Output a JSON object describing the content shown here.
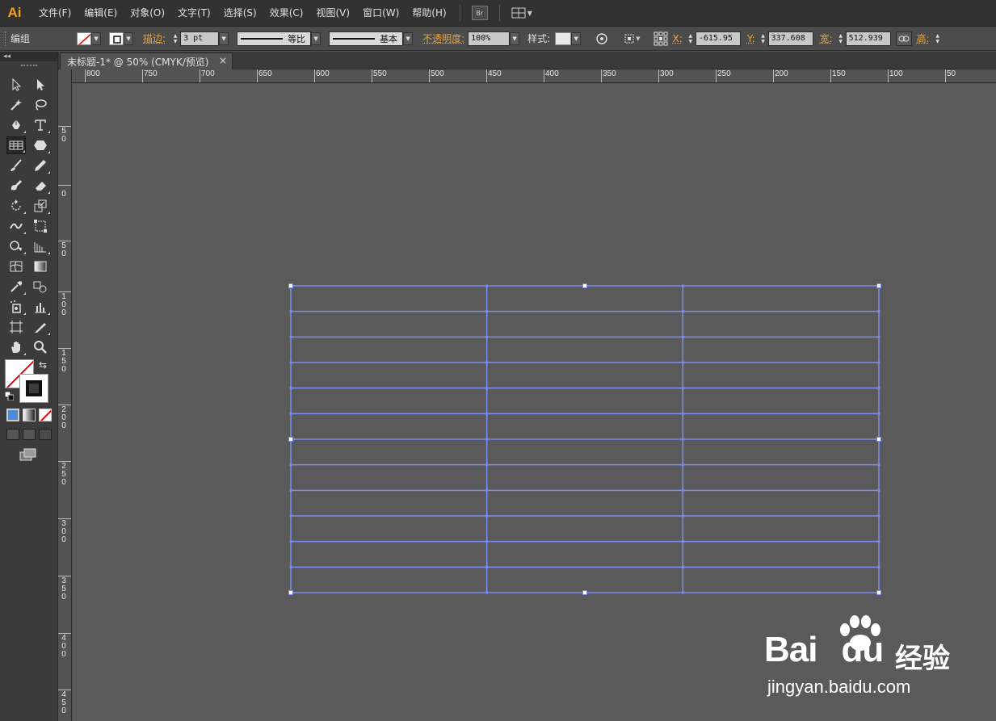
{
  "app": {
    "logo": "Ai"
  },
  "menu": [
    "文件(F)",
    "编辑(E)",
    "对象(O)",
    "文字(T)",
    "选择(S)",
    "效果(C)",
    "视图(V)",
    "窗口(W)",
    "帮助(H)"
  ],
  "menubar_buttons": {
    "bridge": "Br"
  },
  "control": {
    "selection_label": "编组",
    "stroke_label": "描边:",
    "stroke_weight": "3 pt",
    "profile_label": "等比",
    "brush_label": "基本",
    "opacity_label": "不透明度:",
    "opacity_value": "100%",
    "style_label": "样式:",
    "x_label": "X:",
    "x_value": "-615.95",
    "y_label": "Y:",
    "y_value": "337.608",
    "w_label": "宽:",
    "w_value": "512.939",
    "h_label": "高:"
  },
  "tab": {
    "title": "未标题-1* @ 50% (CMYK/预览)",
    "close": "×"
  },
  "toolbox": {
    "collapse": "◂◂"
  },
  "ruler_h": [
    "800",
    "750",
    "700",
    "650",
    "600",
    "550",
    "500",
    "450",
    "400",
    "350",
    "300",
    "250",
    "200",
    "150",
    "100",
    "50"
  ],
  "ruler_v": [
    "50",
    "0",
    "50",
    "100",
    "150",
    "200",
    "250",
    "300",
    "350",
    "400",
    "450"
  ],
  "table": {
    "rows": 12,
    "cols": 3
  },
  "watermark": {
    "brand": "Bai",
    "brand2": "du",
    "suffix": "经验",
    "url": "jingyan.baidu.com"
  },
  "colors": {
    "selection": "#7b8cf0",
    "canvas": "#5a5a5a",
    "accent": "#e8a23c"
  }
}
